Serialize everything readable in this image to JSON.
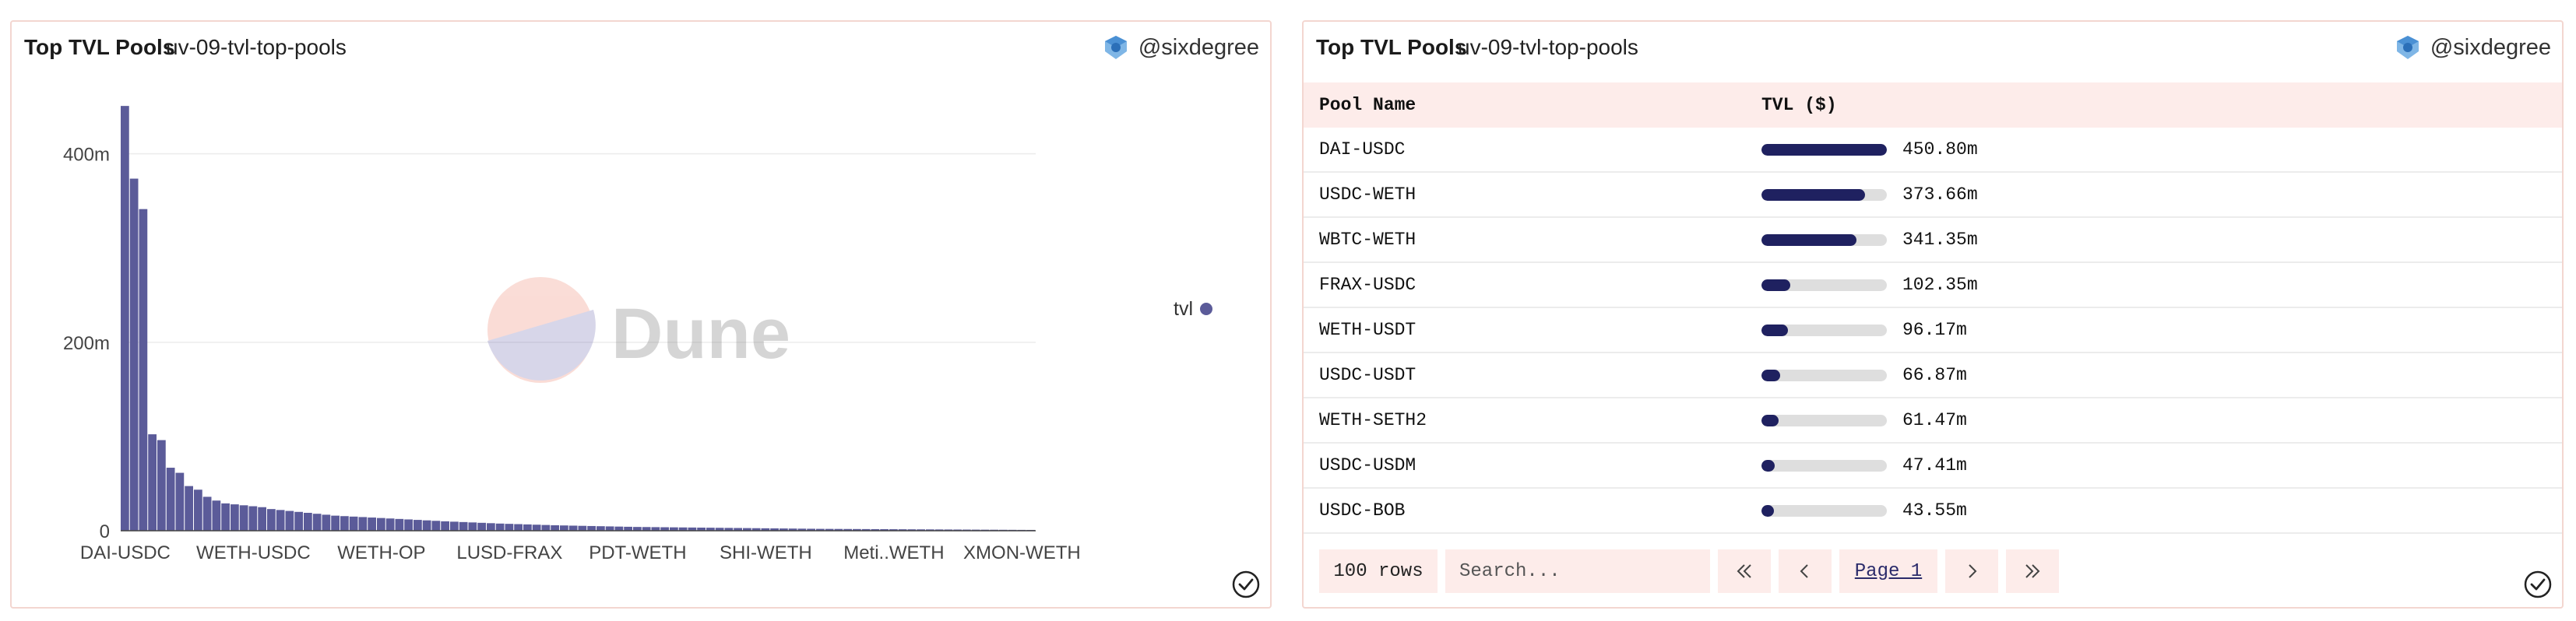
{
  "left_panel": {
    "title": "Top TVL Pools",
    "query": "uv-09-tvl-top-pools",
    "author": "@sixdegree",
    "watermark": "Dune",
    "legend_label": "tvl"
  },
  "right_panel": {
    "title": "Top TVL Pools",
    "query": "uv-09-tvl-top-pools",
    "author": "@sixdegree",
    "columns": [
      "Pool Name",
      "TVL ($)"
    ],
    "rows": [
      {
        "name": "DAI-USDC",
        "tvl": "450.80m",
        "value": 450.8
      },
      {
        "name": "USDC-WETH",
        "tvl": "373.66m",
        "value": 373.66
      },
      {
        "name": "WBTC-WETH",
        "tvl": "341.35m",
        "value": 341.35
      },
      {
        "name": "FRAX-USDC",
        "tvl": "102.35m",
        "value": 102.35
      },
      {
        "name": "WETH-USDT",
        "tvl": "96.17m",
        "value": 96.17
      },
      {
        "name": "USDC-USDT",
        "tvl": "66.87m",
        "value": 66.87
      },
      {
        "name": "WETH-SETH2",
        "tvl": "61.47m",
        "value": 61.47
      },
      {
        "name": "USDC-USDM",
        "tvl": "47.41m",
        "value": 47.41
      },
      {
        "name": "USDC-BOB",
        "tvl": "43.55m",
        "value": 43.55
      }
    ],
    "row_count": "100 rows",
    "search_placeholder": "Search...",
    "page_label": "Page 1"
  },
  "colors": {
    "bar": "#5b5b99",
    "table_bar": "#1f2160",
    "accent_bg": "#fdecea",
    "border": "#f3d6d0"
  },
  "icons": {
    "author": "sixdegree-logo-icon",
    "status": "check-circle-icon",
    "first": "double-chevron-left-icon",
    "prev": "chevron-left-icon",
    "next": "chevron-right-icon",
    "last": "double-chevron-right-icon"
  },
  "chart_data": {
    "type": "bar",
    "title": "",
    "xlabel": "",
    "ylabel": "",
    "series": [
      {
        "name": "tvl",
        "values": [
          450.8,
          373.66,
          341.35,
          102.35,
          96.17,
          66.87,
          61.47,
          47.41,
          43.55,
          36,
          32,
          29,
          28,
          27,
          26,
          25,
          23,
          22,
          21,
          20,
          19,
          18,
          17,
          16,
          15.5,
          15,
          14.5,
          14,
          13.5,
          13,
          12.5,
          12,
          11.5,
          11,
          10.5,
          10,
          9.6,
          9.2,
          8.8,
          8.4,
          8,
          7.6,
          7.3,
          7,
          6.7,
          6.4,
          6.1,
          5.8,
          5.6,
          5.4,
          5.2,
          5,
          4.8,
          4.6,
          4.4,
          4.2,
          4,
          3.9,
          3.8,
          3.7,
          3.6,
          3.5,
          3.4,
          3.3,
          3.2,
          3.1,
          3,
          2.9,
          2.8,
          2.7,
          2.6,
          2.5,
          2.4,
          2.3,
          2.2,
          2.1,
          2,
          1.95,
          1.9,
          1.85,
          1.8,
          1.75,
          1.7,
          1.65,
          1.6,
          1.55,
          1.5,
          1.45,
          1.4,
          1.35,
          1.3,
          1.25,
          1.2,
          1.15,
          1.1,
          1.05,
          1,
          0.95,
          0.9,
          0.85
        ]
      }
    ],
    "x_tick_labels": [
      "DAI-USDC",
      "WETH-USDC",
      "WETH-OP",
      "LUSD-FRAX",
      "PDT-WETH",
      "SHI-WETH",
      "Meti..WETH",
      "XMON-WETH"
    ],
    "y_ticks": [
      {
        "value": 0,
        "label": "0"
      },
      {
        "value": 200,
        "label": "200m"
      },
      {
        "value": 400,
        "label": "400m"
      }
    ],
    "ylim": [
      0,
      460
    ],
    "grid": true,
    "legend_position": "right"
  }
}
